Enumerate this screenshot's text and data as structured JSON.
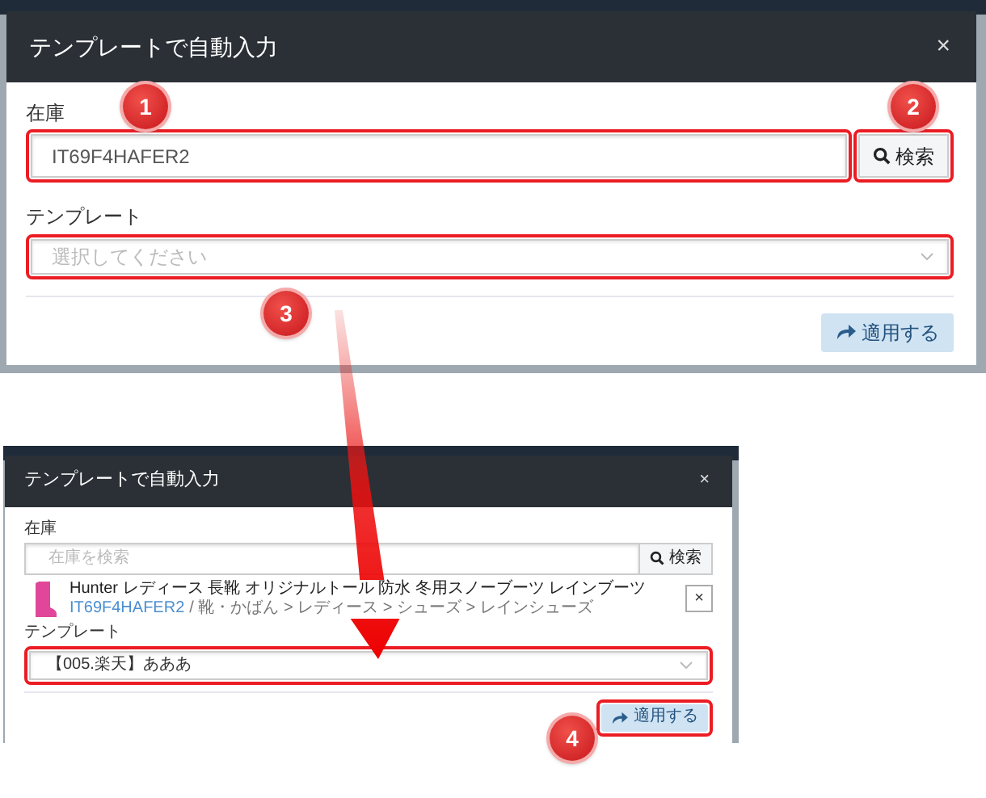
{
  "top_dialog": {
    "title": "テンプレートで自動入力",
    "close": "×",
    "stock_label": "在庫",
    "stock_value": "IT69F4HAFER2",
    "search_button": "検索",
    "template_label": "テンプレート",
    "template_placeholder": "選択してください",
    "apply_button": "適用する"
  },
  "bottom_dialog": {
    "title": "テンプレートで自動入力",
    "close": "×",
    "stock_label": "在庫",
    "stock_placeholder": "在庫を検索",
    "search_button": "検索",
    "product": {
      "name": "Hunter レディース 長靴 オリジナルトール 防水 冬用スノーブーツ レインブーツ",
      "sku": "IT69F4HAFER2",
      "category": "/ 靴・かばん > レディース > シューズ > レインシューズ",
      "remove": "×"
    },
    "template_label": "テンプレート",
    "template_value": "【005.楽天】あああ",
    "apply_button": "適用する"
  },
  "callouts": [
    {
      "number": "1"
    },
    {
      "number": "2"
    },
    {
      "number": "3"
    },
    {
      "number": "4"
    }
  ]
}
